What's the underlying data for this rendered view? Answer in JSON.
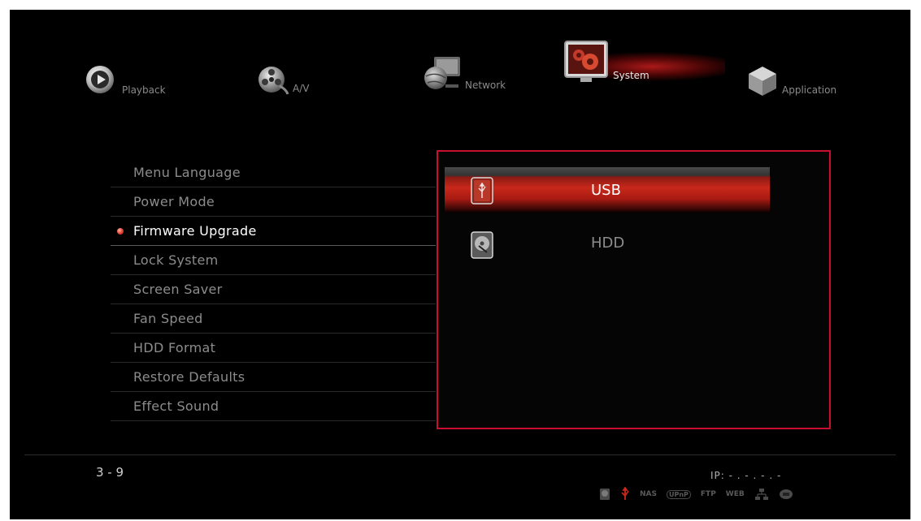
{
  "nav": {
    "items": [
      {
        "label": "Playback",
        "icon": "play-icon"
      },
      {
        "label": "A/V",
        "icon": "film-reel-icon"
      },
      {
        "label": "Network",
        "icon": "globe-monitor-icon"
      },
      {
        "label": "System",
        "icon": "gear-icon"
      },
      {
        "label": "Application",
        "icon": "cube-icon"
      }
    ],
    "active": "System"
  },
  "menu": {
    "items": [
      "Menu Language",
      "Power Mode",
      "Firmware Upgrade",
      "Lock System",
      "Screen Saver",
      "Fan Speed",
      "HDD Format",
      "Restore Defaults",
      "Effect Sound"
    ],
    "selected": "Firmware Upgrade"
  },
  "panel": {
    "options": [
      {
        "label": "USB",
        "icon": "usb-drive-icon"
      },
      {
        "label": "HDD",
        "icon": "hard-disk-icon"
      }
    ],
    "selected": "USB"
  },
  "footer": {
    "page_indicator": "3 - 9",
    "ip_text": "IP: - . - . - . -",
    "status_icons": [
      {
        "name": "hdd-status-icon",
        "text": ""
      },
      {
        "name": "usb-status-icon",
        "text": "",
        "active": true
      },
      {
        "name": "nas-status-icon",
        "text": "NAS"
      },
      {
        "name": "upnp-status-icon",
        "text": "UPnP"
      },
      {
        "name": "ftp-status-icon",
        "text": "FTP"
      },
      {
        "name": "web-status-icon",
        "text": "WEB"
      },
      {
        "name": "lan-status-icon",
        "text": ""
      },
      {
        "name": "wifi-status-icon",
        "text": ""
      }
    ]
  },
  "colors": {
    "accent": "#c8102e",
    "background": "#000000",
    "text_inactive": "#8c8c8c",
    "text_active": "#ffffff"
  }
}
